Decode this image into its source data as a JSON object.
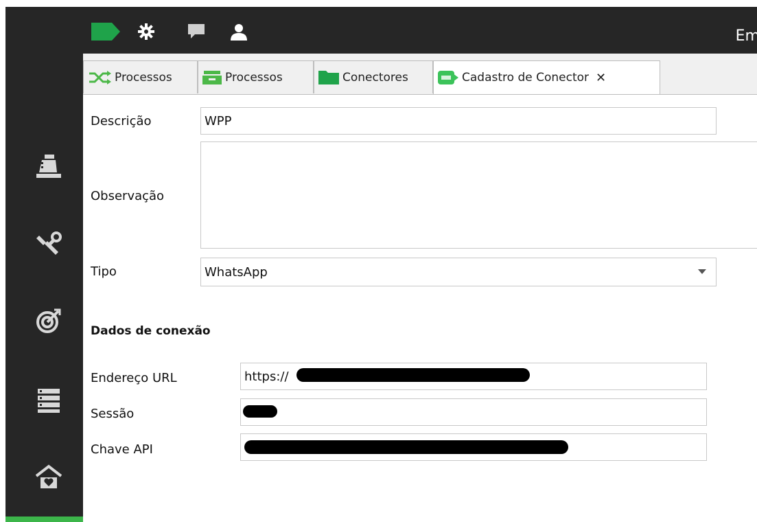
{
  "topbar": {
    "right_text": "Em",
    "icons": [
      "tag-icon",
      "gear-icon",
      "chat-icon",
      "user-icon"
    ]
  },
  "sidebar": {
    "icons": [
      "cash-register-icon",
      "tools-icon",
      "target-icon",
      "list-icon",
      "home-heart-icon"
    ]
  },
  "tabs": [
    {
      "label": "Processos",
      "icon": "shuffle-icon"
    },
    {
      "label": "Processos",
      "icon": "tray-icon"
    },
    {
      "label": "Conectores",
      "icon": "folder-icon"
    },
    {
      "label": "Cadastro de Conector",
      "icon": "connector-icon",
      "close": "✕"
    }
  ],
  "form": {
    "descricao_label": "Descrição",
    "descricao_value": "WPP",
    "observacao_label": "Observação",
    "observacao_value": "",
    "tipo_label": "Tipo",
    "tipo_value": "WhatsApp",
    "conexao_title": "Dados de conexão",
    "url_label": "Endereço URL",
    "url_value": "https://",
    "sessao_label": "Sessão",
    "sessao_value": "",
    "chave_label": "Chave API",
    "chave_value": ""
  },
  "colors": {
    "accent": "#3cb54a",
    "dark": "#262626"
  }
}
